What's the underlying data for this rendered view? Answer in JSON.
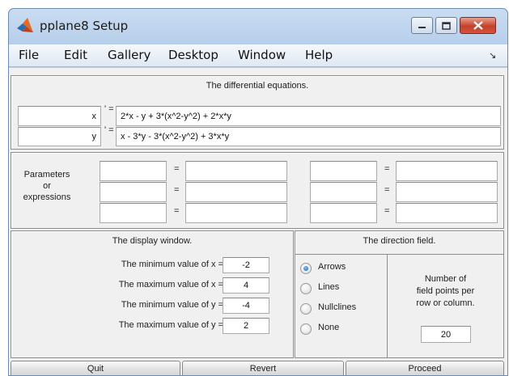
{
  "window": {
    "title": "pplane8 Setup",
    "menus": [
      "File",
      "Edit",
      "Gallery",
      "Desktop",
      "Window",
      "Help"
    ]
  },
  "equations": {
    "heading": "The differential equations.",
    "rows": [
      {
        "variable": "x",
        "prime": "' =",
        "expression": "2*x - y + 3*(x^2-y^2) + 2*x*y"
      },
      {
        "variable": "y",
        "prime": "' =",
        "expression": "x - 3*y - 3*(x^2-y^2) + 3*x*y"
      }
    ]
  },
  "parameters": {
    "label": [
      "Parameters",
      "or",
      "expressions"
    ],
    "equals": "="
  },
  "display_window": {
    "heading": "The display window.",
    "rows": [
      {
        "label": "The minimum value of x =",
        "value": "-2"
      },
      {
        "label": "The maximum value of x =",
        "value": "4"
      },
      {
        "label": "The minimum value of y =",
        "value": "-4"
      },
      {
        "label": "The maximum value of y =",
        "value": "2"
      }
    ]
  },
  "direction_field": {
    "heading": "The direction field.",
    "options": [
      "Arrows",
      "Lines",
      "Nullclines",
      "None"
    ],
    "selected": "Arrows",
    "points_label": [
      "Number of",
      "field points per",
      "row or column."
    ],
    "points_value": "20"
  },
  "buttons": {
    "quit": "Quit",
    "revert": "Revert",
    "proceed": "Proceed"
  },
  "colors": {
    "title_gradient": "#c9dcf1",
    "close_button": "#c4402b",
    "radio_selected": "#1a5fb4",
    "client_bg": "#f0f0f0"
  }
}
